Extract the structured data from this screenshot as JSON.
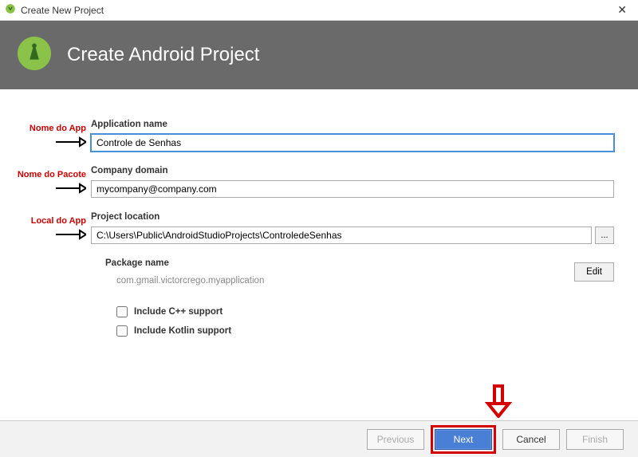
{
  "window": {
    "title": "Create New Project"
  },
  "header": {
    "title": "Create Android Project"
  },
  "annotations": {
    "app_name": "Nome do App",
    "package": "Nome do Pacote",
    "location": "Local do App"
  },
  "fields": {
    "app_name": {
      "label": "Application name",
      "value": "Controle de Senhas"
    },
    "company_domain": {
      "label": "Company domain",
      "value": "mycompany@company.com"
    },
    "project_location": {
      "label": "Project location",
      "value": "C:\\Users\\Public\\AndroidStudioProjects\\ControledeSenhas",
      "browse": "..."
    },
    "package_name": {
      "label": "Package name",
      "value": "com.gmail.victorcrego.myapplication",
      "edit": "Edit"
    }
  },
  "checkboxes": {
    "cpp": {
      "label": "Include C++ support",
      "checked": false
    },
    "kotlin": {
      "label": "Include Kotlin support",
      "checked": false
    }
  },
  "footer": {
    "previous": "Previous",
    "next": "Next",
    "cancel": "Cancel",
    "finish": "Finish"
  }
}
